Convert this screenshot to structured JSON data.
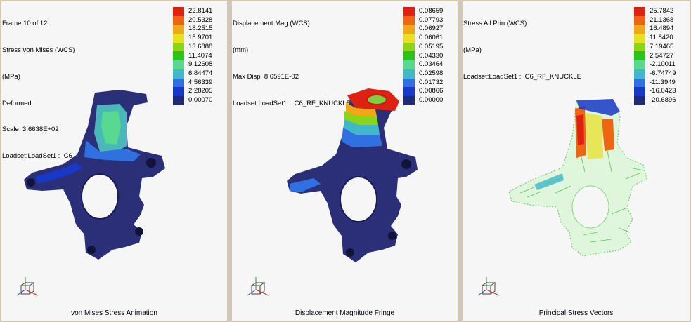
{
  "panels": [
    {
      "info": [
        "Frame 10 of 12",
        "Stress von Mises (WCS)",
        "(MPa)",
        "Deformed",
        "Scale  3.6638E+02",
        "Loadset:LoadSet1 :  C6_RF_KNUCKLE"
      ],
      "legend": [
        "22.8141",
        "20.5328",
        "18.2515",
        "15.9701",
        "13.6888",
        "11.4074",
        "9.12608",
        "6.84474",
        "4.56339",
        "2.28205",
        "0.00070"
      ],
      "caption": "von Mises Stress Animation"
    },
    {
      "info": [
        "Displacement Mag (WCS)",
        "(mm)",
        "Max Disp  8.6591E-02",
        "Loadset:LoadSet1 :  C6_RF_KNUCKLE"
      ],
      "legend": [
        "0.08659",
        "0.07793",
        "0.06927",
        "0.06061",
        "0.05195",
        "0.04330",
        "0.03464",
        "0.02598",
        "0.01732",
        "0.00866",
        "0.00000"
      ],
      "caption": "Displacement Magnitude Fringe"
    },
    {
      "info": [
        "Stress All Prin (WCS)",
        "(MPa)",
        "Loadset:LoadSet1 :  C6_RF_KNUCKLE"
      ],
      "legend": [
        "25.7842",
        "21.1368",
        "16.4894",
        "11.8420",
        "7.19465",
        "2.54727",
        "-2.10011",
        "-6.74749",
        "-11.3949",
        "-16.0423",
        "-20.6896"
      ],
      "caption": "Principal Stress Vectors"
    }
  ],
  "colors": {
    "scale": [
      "#dd2211",
      "#ee6611",
      "#f0a818",
      "#e8e020",
      "#8cd418",
      "#2cc418",
      "#58d890",
      "#40b8c8",
      "#3070e0",
      "#1838c8",
      "#202878"
    ],
    "model_dark": "#2a2f78",
    "panel_bg": "#f6f6f6",
    "panel_border": "#d7c9a8"
  }
}
